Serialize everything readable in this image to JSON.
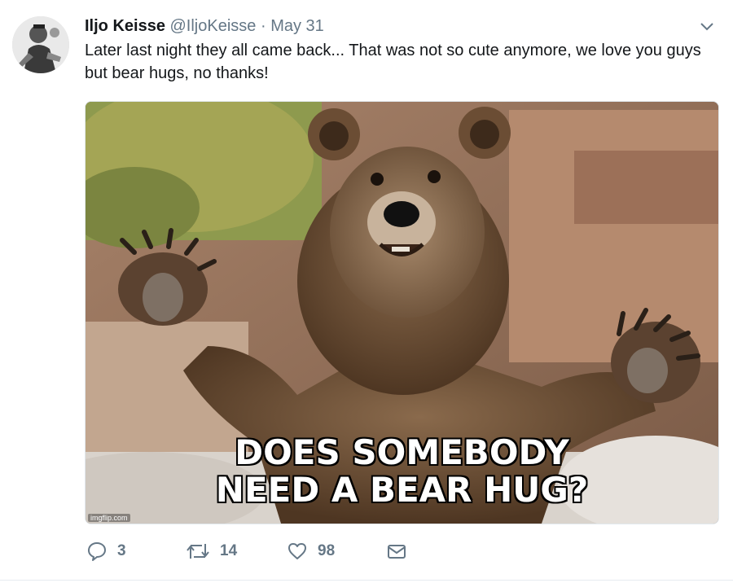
{
  "tweet": {
    "author_name": "Iljo Keisse",
    "handle": "@IljoKeisse",
    "separator": "·",
    "date": "May 31",
    "text": "Later last night they all came back... That was not so cute anymore, we love you guys but bear hugs, no thanks!",
    "media": {
      "caption_line1": "DOES SOMEBODY",
      "caption_line2": "NEED A BEAR HUG?",
      "watermark": "imgflip.com"
    },
    "actions": {
      "replies": "3",
      "retweets": "14",
      "likes": "98"
    }
  },
  "colors": {
    "text": "#14171a",
    "secondary": "#657786",
    "border": "#e1e8ed"
  },
  "icons": [
    "chevron-down-icon",
    "reply-icon",
    "retweet-icon",
    "like-icon",
    "message-icon"
  ]
}
